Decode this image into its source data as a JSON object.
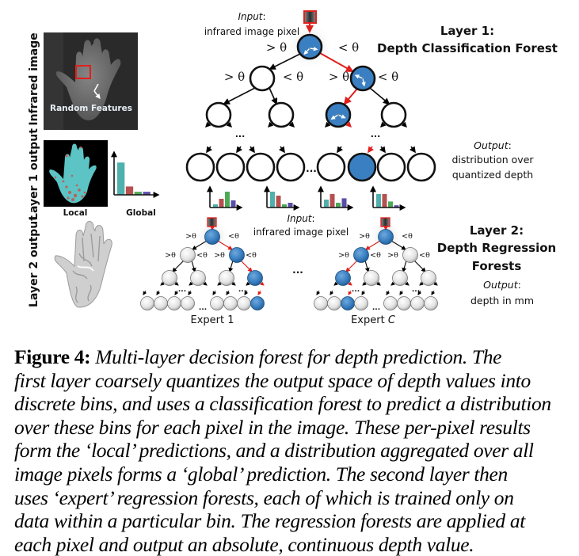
{
  "figure": {
    "row_labels": {
      "infrared": "Infrared image",
      "layer1": "Layer 1 output",
      "layer2": "Layer 2 output"
    },
    "infrared_panel": {
      "annotation": "Random Features",
      "highlight_color": "#e0201c"
    },
    "layer1_panel": {
      "local_label": "Local",
      "global_label": "Global",
      "global_histogram": [
        0.85,
        0.22,
        0.08,
        0.08
      ]
    },
    "layer1": {
      "title_line1": "Layer 1:",
      "title_line2": "Depth Classification Forest",
      "input_label": "Input",
      "input_suffix": ":",
      "input_desc": "infrared image pixel",
      "output_label": "Output",
      "output_suffix": ":",
      "output_line1": "distribution over",
      "output_line2": "quantized depth",
      "split_greater": "> θ",
      "split_less": "< θ",
      "ellipsis": "...",
      "leaf_histograms": [
        [
          0.2,
          0.55,
          1.0,
          0.45
        ],
        [
          1.0,
          0.75,
          0.2,
          0.3
        ],
        [
          0.5,
          0.85,
          0.3,
          0.58
        ],
        [
          0.85,
          0.85,
          0.38,
          0.14
        ]
      ]
    },
    "layer2": {
      "title_line1": "Layer 2:",
      "title_line2": "Depth Regression",
      "title_line3": "Forests",
      "input_label": "Input",
      "input_suffix": ":",
      "input_desc": "infrared image pixel",
      "output_label": "Output",
      "output_suffix": ":",
      "output_desc": "depth in mm",
      "expert_1": "Expert 1",
      "expert_c_prefix": "Expert ",
      "expert_c_var": "C",
      "split_greater": ">θ",
      "split_less": "<θ",
      "ellipsis": "..."
    },
    "colors": {
      "active_node": "#3a7fc1",
      "active_path": "#e0201c",
      "hist_teal": "#4fb0ad",
      "hist_red": "#b5504f",
      "hist_green": "#4ea957",
      "hist_purple": "#5a4da8"
    }
  },
  "caption": {
    "label": "Figure 4:",
    "lines": [
      "Multi-layer decision forest for depth prediction.  The",
      "first layer coarsely quantizes the output space of depth values into",
      "discrete bins, and uses a classification forest to predict a distribution",
      "over these bins for each pixel in the image. These per-pixel results",
      "form the ‘local’ predictions, and a distribution aggregated over all",
      "image pixels forms a ‘global’ prediction.  The second layer then",
      "uses ‘expert’ regression forests, each of which is trained only on",
      "data within a particular bin. The regression forests are applied at",
      "each pixel and output an absolute, continuous depth value."
    ]
  }
}
